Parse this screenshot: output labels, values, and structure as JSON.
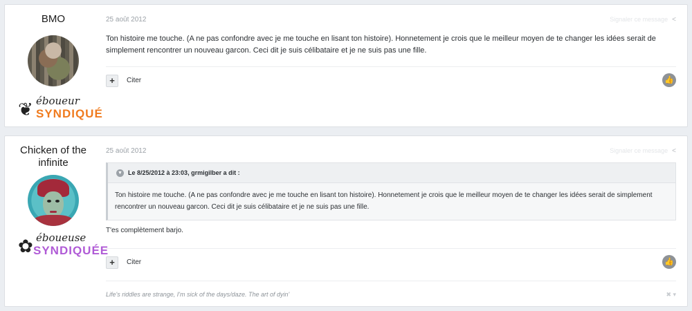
{
  "posts": [
    {
      "author": "BMO",
      "avatar": "pixelated-portrait-avatar",
      "badge": {
        "top": "éboueur",
        "bottom": "SYNDIQUÉ",
        "icon": "spray-can-icon"
      },
      "date": "25 août 2012",
      "report_label": "Signaler ce message",
      "text": "Ton histoire me touche. (A ne pas confondre avec je me touche en lisant ton histoire). Honnetement je crois que le meilleur moyen de te changer les idées serait de simplement rencontrer un nouveau garcon. Ceci dit je suis célibataire et je ne suis pas une fille.",
      "plus_label": "+",
      "cite_label": "Citer",
      "like_icon": "thumbs-up-icon"
    },
    {
      "author": "Chicken of the infinite",
      "avatar": "painted-woman-portrait-avatar",
      "badge": {
        "top": "éboueuse",
        "bottom": "SYNDIQUÉE",
        "icon": "flower-icon"
      },
      "date": "25 août 2012",
      "report_label": "Signaler ce message",
      "quote": {
        "header": "Le 8/25/2012 à 23:03, grmigilber a dit :",
        "text": "Ton histoire me touche. (A ne pas confondre avec je me touche en lisant ton histoire). Honnetement je crois que le meilleur moyen de te changer les idées serait de simplement rencontrer un nouveau garcon. Ceci dit je suis célibataire et je ne suis pas une fille."
      },
      "text": "T'es complètement barjo.",
      "plus_label": "+",
      "cite_label": "Citer",
      "like_icon": "thumbs-up-icon",
      "signature": "Life's riddles are strange, I'm sick of the days/daze. The art of dyin'"
    }
  ],
  "colors": {
    "badge1": "#f07b1e",
    "badge2": "#b05bd6",
    "background": "#ebeef2"
  }
}
